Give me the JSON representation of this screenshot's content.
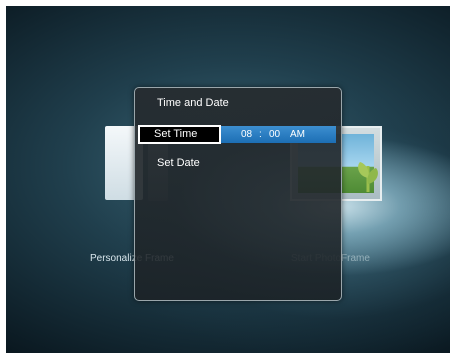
{
  "background": {
    "left_caption": "Personalize Frame",
    "right_caption": "Start PhotoFrame"
  },
  "dialog": {
    "title": "Time and Date",
    "items": [
      {
        "label": "Set Time",
        "selected": true
      },
      {
        "label": "Set Date",
        "selected": false
      }
    ],
    "time": {
      "hours": "08",
      "separator": ":",
      "minutes": "00",
      "ampm": "AM"
    }
  },
  "colors": {
    "highlight": "#1c6eb4",
    "dialog_bg": "#262c30",
    "background": "#203f4d"
  }
}
